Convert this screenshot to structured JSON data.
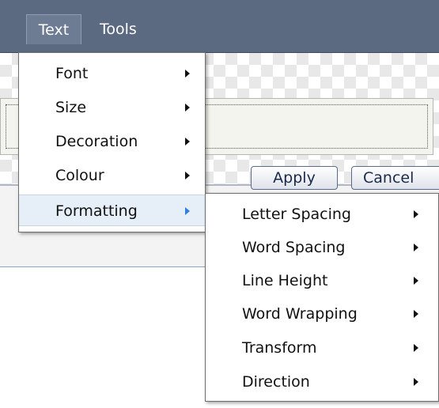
{
  "menubar": {
    "items": [
      {
        "label": "Text",
        "active": true
      },
      {
        "label": "Tools",
        "active": false
      }
    ]
  },
  "buttons": {
    "apply": "Apply",
    "cancel": "Cancel"
  },
  "text_menu": {
    "items": [
      {
        "label": "Font",
        "has_submenu": true
      },
      {
        "label": "Size",
        "has_submenu": true
      },
      {
        "label": "Decoration",
        "has_submenu": true
      },
      {
        "label": "Colour",
        "has_submenu": true
      },
      {
        "label": "Formatting",
        "has_submenu": true,
        "highlighted": true
      }
    ]
  },
  "formatting_submenu": {
    "items": [
      {
        "label": "Letter Spacing",
        "has_submenu": true
      },
      {
        "label": "Word Spacing",
        "has_submenu": true
      },
      {
        "label": "Line Height",
        "has_submenu": true
      },
      {
        "label": "Word Wrapping",
        "has_submenu": true
      },
      {
        "label": "Transform",
        "has_submenu": true
      },
      {
        "label": "Direction",
        "has_submenu": true
      }
    ]
  },
  "colors": {
    "menubar_bg": "#5b6a80",
    "highlight_bg": "#e6eef8",
    "highlight_arrow": "#2f7fe0"
  }
}
